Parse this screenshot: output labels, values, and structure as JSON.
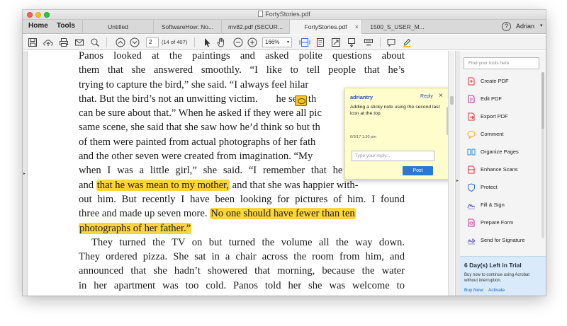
{
  "window": {
    "title": "FortyStories.pdf"
  },
  "nav": {
    "home": "Home",
    "tools": "Tools"
  },
  "tabs": [
    {
      "label": "Untitled"
    },
    {
      "label": "SoftwareHow: No..."
    },
    {
      "label": "mv82.pdf (SECUR..."
    },
    {
      "label": "FortyStories.pdf",
      "active": true
    },
    {
      "label": "1500_S_USER_M..."
    }
  ],
  "tab_close": "×",
  "help": "?",
  "user": {
    "name": "Adrian"
  },
  "toolbar": {
    "page_current": "2",
    "page_of": "(14 of 407)",
    "zoom": "166%"
  },
  "document": {
    "lines": [
      "Panos looked at the paintings and asked polite questions about",
      "them that she answered smoothly. “I like to tell people that he’s",
      "trying to capture the bird,” she said. “I always feel hilar",
      "that. But the bird’s not an unwitting victim.",
      "can be sure about that.” When he asked if they were all pic",
      "same scene, she said that she saw how he’d think so but th",
      "of them were painted from actual photographs of her fath",
      "and the other seven were created from imagination. “My",
      "when I was a little girl,” she said. “I remember that he yelled a lot,",
      "and that she was happier with-",
      "out him. But recently I have been looking for pictures of him. I found",
      "three and made up seven more.",
      "photographs of her father.”",
      "They turned the TV on but turned the volume all the way down.",
      "They ordered pizza. She sat in a chair across the room from him, and",
      "announced that she hadn’t showered that morning, because the water",
      "in her apartment was too cold. Panos told her she was welcome to"
    ],
    "line4_tail": "he sees th",
    "highlight_1": "that he was mean to my mother,",
    "highlight_2": "No one should have fewer than ten"
  },
  "comment": {
    "user": "adriantry",
    "reply": "Reply",
    "close": "×",
    "message": "Adding a sticky note using the second last icon at the top.",
    "date": "6/9/17  1:30 pm",
    "reply_placeholder": "Type your reply...",
    "post": "Post"
  },
  "tools_pane": {
    "search_placeholder": "Find your tools here",
    "items": [
      {
        "label": "Create PDF",
        "icon": "create-pdf-icon",
        "color": "#d9373f"
      },
      {
        "label": "Edit PDF",
        "icon": "edit-pdf-icon",
        "color": "#c2309a"
      },
      {
        "label": "Export PDF",
        "icon": "export-pdf-icon",
        "color": "#d9373f"
      },
      {
        "label": "Comment",
        "icon": "comment-icon",
        "color": "#f0b21a"
      },
      {
        "label": "Organize Pages",
        "icon": "organize-pages-icon",
        "color": "#2b8fd6"
      },
      {
        "label": "Enhance Scans",
        "icon": "enhance-scans-icon",
        "color": "#d9373f"
      },
      {
        "label": "Protect",
        "icon": "protect-icon",
        "color": "#2b6fd6"
      },
      {
        "label": "Fill & Sign",
        "icon": "fill-sign-icon",
        "color": "#5b4fc7"
      },
      {
        "label": "Prepare Form",
        "icon": "prepare-form-icon",
        "color": "#c2309a"
      },
      {
        "label": "Send for Signature",
        "icon": "send-signature-icon",
        "color": "#5b4fc7"
      }
    ]
  },
  "trial": {
    "title": "6 Day(s) Left in Trial",
    "body": "Buy now to continue using Acrobat without interruption.",
    "buy": "Buy Now",
    "sep": "|",
    "activate": "Activate"
  }
}
